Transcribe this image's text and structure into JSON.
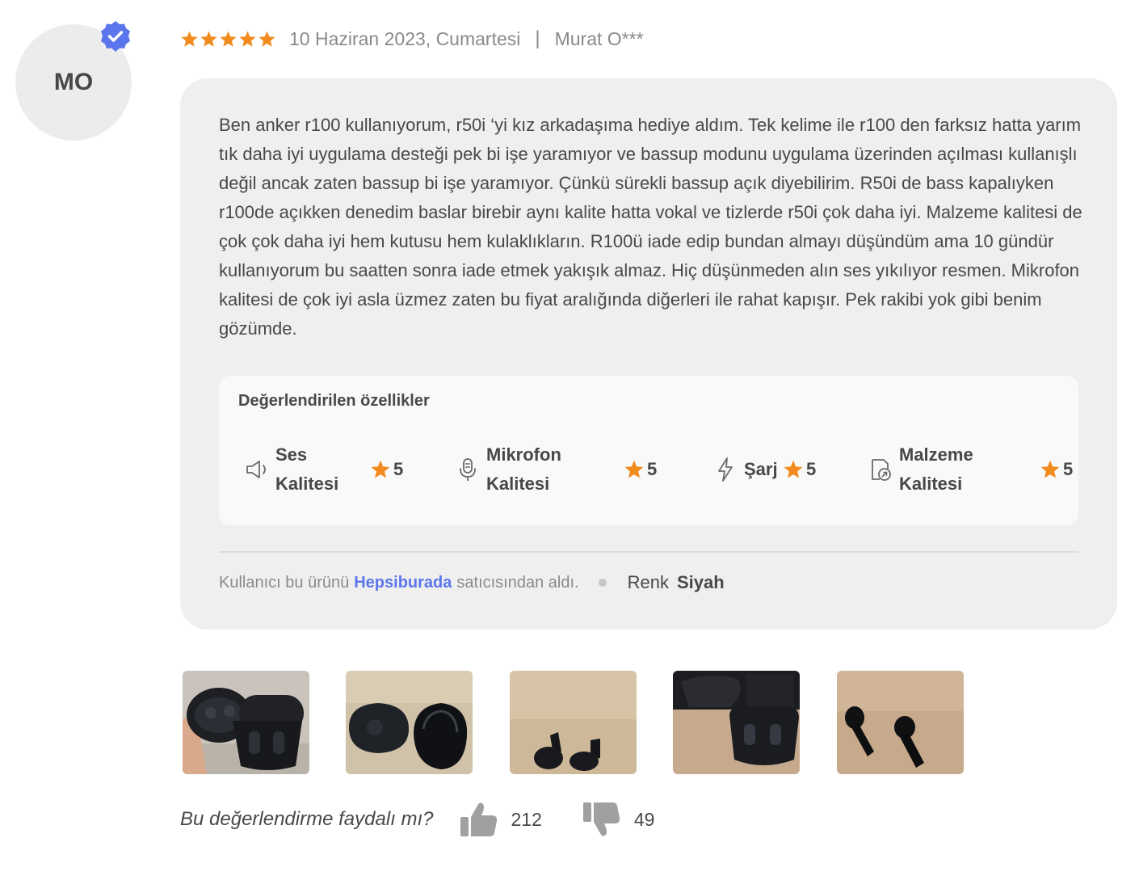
{
  "reviewer": {
    "initials": "MO",
    "name": "Murat O***",
    "verified_icon": "verified-badge-icon"
  },
  "review": {
    "rating": 5,
    "date": "10 Haziran 2023, Cumartesi",
    "separator": "|",
    "text": "Ben anker r100 kullanıyorum, r50i ‘yi kız arkadaşıma hediye aldım. Tek kelime ile r100 den farksız hatta yarım tık daha iyi  uygulama desteği pek bi işe yaramıyor ve bassup modunu uygulama üzerinden açılması kullanışlı değil ancak zaten bassup bi işe yaramıyor. Çünkü sürekli bassup açık diyebilirim. R50i de bass kapalıyken r100de açıkken denedim baslar birebir aynı kalite hatta vokal ve tizlerde r50i çok daha iyi. Malzeme kalitesi de çok çok daha iyi hem kutusu hem kulaklıkların. R100ü iade edip bundan almayı düşündüm ama 10 gündür kullanıyorum bu saatten sonra iade etmek yakışık almaz. Hiç düşünmeden alın ses yıkılıyor resmen. Mikrofon kalitesi de çok iyi asla üzmez zaten bu fiyat aralığında diğerleri ile rahat kapışır. Pek rakibi yok gibi benim gözümde."
  },
  "features": {
    "title": "Değerlendirilen özellikler",
    "items": [
      {
        "line1": "Ses",
        "line2": "Kalitesi",
        "rating": "5",
        "icon": "speaker-icon"
      },
      {
        "line1": "Mikrofon",
        "line2": "Kalitesi",
        "rating": "5",
        "icon": "microphone-icon"
      },
      {
        "line1": "Şarj",
        "line2": "",
        "rating": "5",
        "icon": "lightning-icon"
      },
      {
        "line1": "Malzeme",
        "line2": "Kalitesi",
        "rating": "5",
        "icon": "material-icon"
      }
    ]
  },
  "seller": {
    "prefix": "Kullanıcı bu ürünü",
    "name": "Hepsiburada",
    "suffix": "satıcısından aldı.",
    "color_label": "Renk",
    "color_value": "Siyah"
  },
  "photos": [
    "earbuds-in-open-case-photo",
    "closed-cases-photo",
    "earbuds-on-table-photo",
    "open-case-photo",
    "earbuds-pair-photo"
  ],
  "helpful": {
    "question": "Bu değerlendirme faydalı mı?",
    "likes": "212",
    "dislikes": "49"
  },
  "colors": {
    "star": "#f28b1e",
    "verified": "#5b76ec",
    "link": "#5b76ec",
    "card_bg": "#efefef"
  }
}
